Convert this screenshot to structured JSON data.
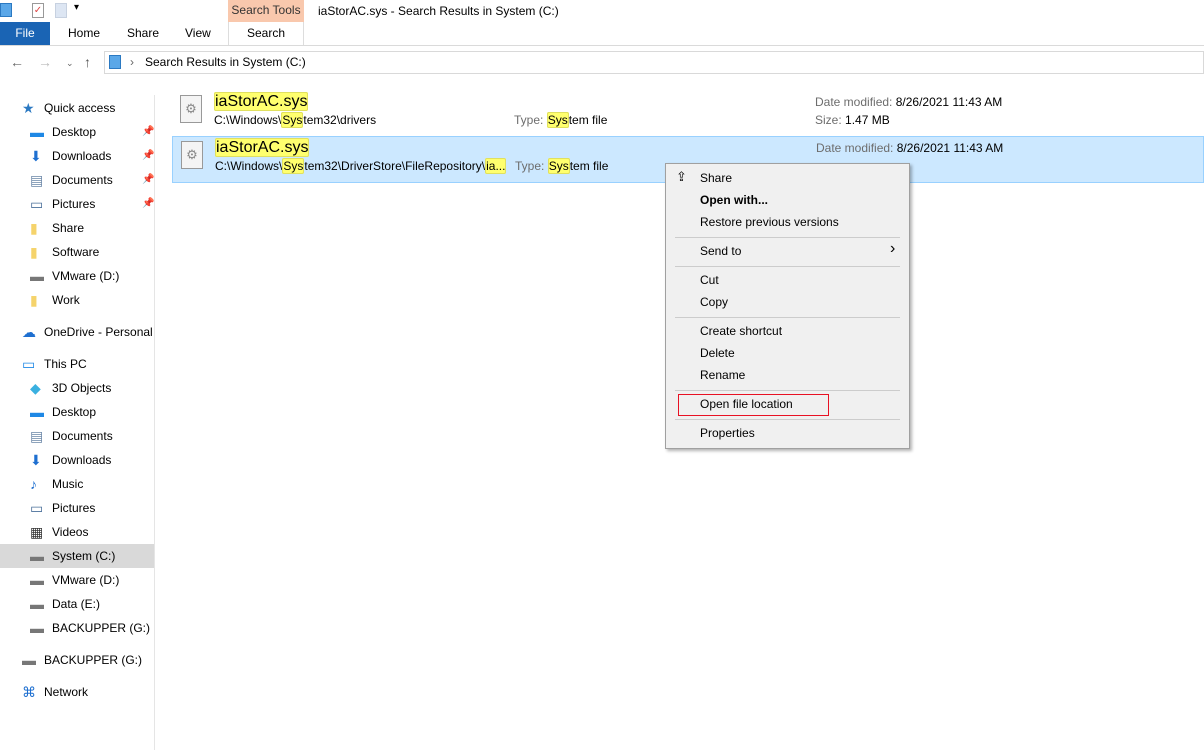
{
  "window": {
    "title": "iaStorAC.sys - Search Results in System (C:)",
    "context_tab": "Search Tools"
  },
  "ribbon": {
    "tabs": [
      "File",
      "Home",
      "Share",
      "View",
      "Search"
    ]
  },
  "address": {
    "path": "Search Results in System (C:)"
  },
  "sidebar": {
    "items": [
      {
        "label": "Quick access",
        "icon": "star-icon",
        "level": 0,
        "pinned": false
      },
      {
        "label": "Desktop",
        "icon": "desktop-icon",
        "level": 1,
        "pinned": true
      },
      {
        "label": "Downloads",
        "icon": "download-icon",
        "level": 1,
        "pinned": true
      },
      {
        "label": "Documents",
        "icon": "documents-icon",
        "level": 1,
        "pinned": true
      },
      {
        "label": "Pictures",
        "icon": "pictures-icon",
        "level": 1,
        "pinned": true
      },
      {
        "label": "Share",
        "icon": "folder-icon",
        "level": 1,
        "pinned": false
      },
      {
        "label": "Software",
        "icon": "folder-icon",
        "level": 1,
        "pinned": false
      },
      {
        "label": "VMware (D:)",
        "icon": "drive-icon",
        "level": 1,
        "pinned": false
      },
      {
        "label": "Work",
        "icon": "folder-icon",
        "level": 1,
        "pinned": false
      },
      {
        "label": "OneDrive - Personal",
        "icon": "cloud-icon",
        "level": 0,
        "pinned": false
      },
      {
        "label": "This PC",
        "icon": "pc-icon",
        "level": 0,
        "pinned": false
      },
      {
        "label": "3D Objects",
        "icon": "cube-icon",
        "level": 1,
        "pinned": false
      },
      {
        "label": "Desktop",
        "icon": "desktop-icon",
        "level": 1,
        "pinned": false
      },
      {
        "label": "Documents",
        "icon": "documents-icon",
        "level": 1,
        "pinned": false
      },
      {
        "label": "Downloads",
        "icon": "download-icon",
        "level": 1,
        "pinned": false
      },
      {
        "label": "Music",
        "icon": "music-icon",
        "level": 1,
        "pinned": false
      },
      {
        "label": "Pictures",
        "icon": "pictures-icon",
        "level": 1,
        "pinned": false
      },
      {
        "label": "Videos",
        "icon": "video-icon",
        "level": 1,
        "pinned": false
      },
      {
        "label": "System (C:)",
        "icon": "drive-icon",
        "level": 1,
        "pinned": false,
        "selected": true
      },
      {
        "label": "VMware (D:)",
        "icon": "drive-icon",
        "level": 1,
        "pinned": false
      },
      {
        "label": "Data (E:)",
        "icon": "drive-icon",
        "level": 1,
        "pinned": false
      },
      {
        "label": "BACKUPPER (G:)",
        "icon": "drive-icon",
        "level": 1,
        "pinned": false
      },
      {
        "label": "BACKUPPER (G:)",
        "icon": "drive-icon",
        "level": 0,
        "pinned": false
      },
      {
        "label": "Network",
        "icon": "network-icon",
        "level": 0,
        "pinned": false
      }
    ]
  },
  "results": [
    {
      "name": "iaStorAC.sys",
      "path_pre": "C:\\Windows\\",
      "path_hl": "Sys",
      "path_post": "tem32\\drivers",
      "path_hl2": "",
      "type_label": "Type:",
      "type_hl": "Sys",
      "type_post": "tem file",
      "date_label": "Date modified:",
      "date": "8/26/2021 11:43 AM",
      "size_label": "Size:",
      "size": "1.47 MB"
    },
    {
      "name": "iaStorAC.sys",
      "path_pre": "C:\\Windows\\",
      "path_hl": "Sys",
      "path_post": "tem32\\DriverStore\\FileRepository\\",
      "path_hl2": "ia...",
      "type_label": "Type:",
      "type_hl": "Sys",
      "type_post": "tem file",
      "date_label": "Date modified:",
      "date": "8/26/2021 11:43 AM",
      "selected": true
    }
  ],
  "context_menu": {
    "items": [
      "Share",
      "Open with...",
      "Restore previous versions",
      "Send to",
      "Cut",
      "Copy",
      "Create shortcut",
      "Delete",
      "Rename",
      "Open file location",
      "Properties"
    ]
  },
  "colors": {
    "accent": "#1a64b4",
    "selection": "#cce8ff",
    "highlight": "#ffff6e",
    "outline": "#e81123"
  }
}
